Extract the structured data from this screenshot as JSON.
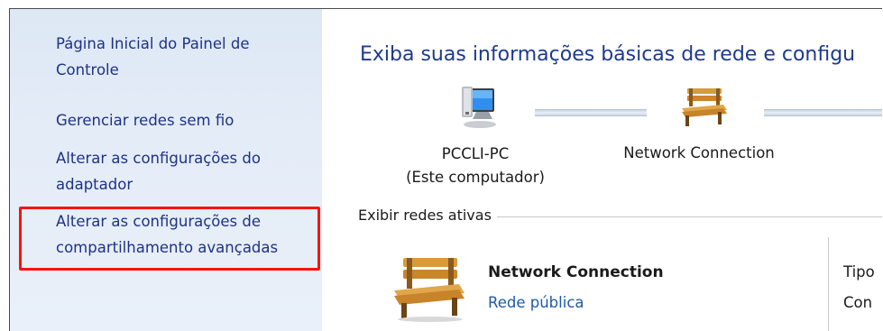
{
  "sidebar": {
    "links": [
      {
        "label_line1": "Página Inicial do Painel de",
        "label_line2": "Controle"
      },
      {
        "label_line1": "Gerenciar redes sem fio",
        "label_line2": ""
      },
      {
        "label_line1": "Alterar as configurações do",
        "label_line2": "adaptador"
      },
      {
        "label_line1": "Alterar as configurações de",
        "label_line2": "compartilhamento avançadas"
      }
    ]
  },
  "main": {
    "title": "Exiba suas informações básicas de rede e configu",
    "map": {
      "computer_name": "PCCLI-PC",
      "computer_sub": "(Este computador)",
      "network_name": "Network Connection",
      "computer_icon": "computer-monitor-icon",
      "network_icon": "park-bench-icon"
    },
    "active_section_label": "Exibir redes ativas",
    "active_network": {
      "name": "Network Connection",
      "type_link": "Rede pública",
      "col_label_1": "Tipo",
      "col_label_2": "Con"
    }
  },
  "colors": {
    "link": "#1e3287",
    "title": "#1e3b8a",
    "highlight": "#ff1010",
    "sidebar_bg": "#dde8f5"
  }
}
